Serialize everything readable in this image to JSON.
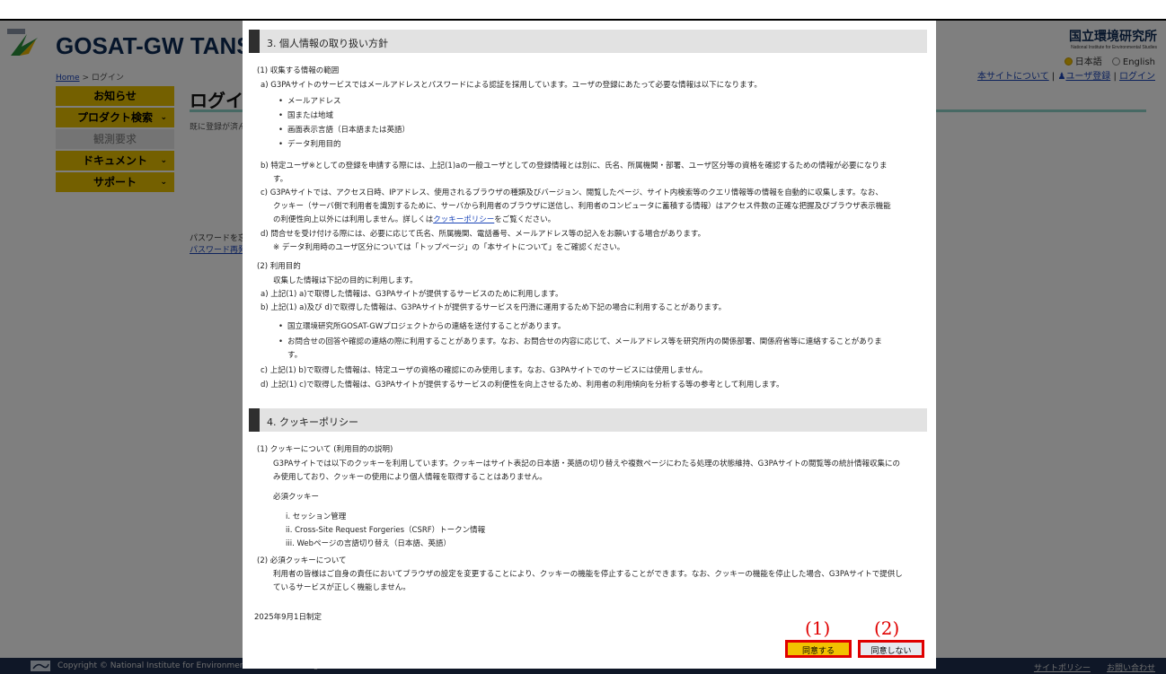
{
  "header": {
    "logo_small": "GOSAT-GW",
    "site_title": "GOSAT-GW TANSO",
    "nies_name_jp": "国立環境研究所",
    "nies_name_en": "National Institute for Environmental Studies",
    "lang_ja": "日本語",
    "lang_en": "English",
    "breadcrumb_home": "Home",
    "breadcrumb_sep": " > ",
    "breadcrumb_current": "ログイン",
    "link_about": "本サイトについて",
    "link_register": "ユーザ登録",
    "link_login": "ログイン"
  },
  "sidebar": {
    "items": [
      {
        "label": "お知らせ",
        "has_chevron": false
      },
      {
        "label": "プロダクト検索",
        "has_chevron": true
      },
      {
        "label": "観測要求",
        "has_chevron": false
      },
      {
        "label": "ドキュメント",
        "has_chevron": true
      },
      {
        "label": "サポート",
        "has_chevron": true
      }
    ]
  },
  "main": {
    "page_title": "ログイン",
    "login_note": "既に登録が済ん",
    "pw_text": "パスワードを忘",
    "pw_link": "パスワード再発"
  },
  "footer": {
    "copyright": "Copyright © National Institute for Environmental Studies. All Rights Reserved.",
    "link_policy": "サイトポリシー",
    "link_contact": "お問い合わせ"
  },
  "modal": {
    "sec3_title": "3. 個人情報の取り扱い方針",
    "s3_1": "(1) 収集する情報の範囲",
    "s3_1a": "a) G3PAサイトのサービスではメールアドレスとパスワードによる認証を採用しています。ユーザの登録にあたって必要な情報は以下になります。",
    "s3_1a_items": [
      "メールアドレス",
      "国または地域",
      "画面表示言語（日本語または英語）",
      "データ利用目的"
    ],
    "s3_1b_1": "b) 特定ユーザ※としての登録を申請する際には、上記(1)aの一般ユーザとしての登録情報とは別に、氏名、所属機関・部署、ユーザ区分等の資格を確認するための情報が必要になりま",
    "s3_1b_2": "す。",
    "s3_1c_1": "c) G3PAサイトでは、アクセス日時、IPアドレス、使用されるブラウザの種類及びバージョン、閲覧したページ、サイト内検索等のクエリ情報等の情報を自動的に収集します。なお、",
    "s3_1c_2": "クッキー（サーバ側で利用者を識別するために、サーバから利用者のブラウザに送信し、利用者のコンピュータに蓄積する情報）はアクセス件数の正確な把握及びブラウザ表示機能",
    "s3_1c_3a": "の利便性向上以外には利用しません。詳しくは",
    "s3_1c_3link": "クッキーポリシー",
    "s3_1c_3b": "をご覧ください。",
    "s3_1d": "d) 問合せを受け付ける際には、必要に応じて氏名、所属機関、電話番号、メールアドレス等の記入をお願いする場合があります。",
    "s3_1note": "※ データ利用時のユーザ区分については「トップページ」の「本サイトについて」をご確認ください。",
    "s3_2": "(2) 利用目的",
    "s3_2intro": "収集した情報は下記の目的に利用します。",
    "s3_2a": "a) 上記(1) a)で取得した情報は、G3PAサイトが提供するサービスのために利用します。",
    "s3_2b": "b) 上記(1) a)及び d)で取得した情報は、G3PAサイトが提供するサービスを円滑に運用するため下記の場合に利用することがあります。",
    "s3_2b_i1": "国立環境研究所GOSAT-GWプロジェクトからの連絡を送付することがあります。",
    "s3_2b_i2_1": "お問合せの回答や確認の連絡の際に利用することがあります。なお、お問合せの内容に応じて、メールアドレス等を研究所内の関係部署、関係府省等に連絡することがありま",
    "s3_2b_i2_2": "す。",
    "s3_2c": "c) 上記(1) b)で取得した情報は、特定ユーザの資格の確認にのみ使用します。なお、G3PAサイトでのサービスには使用しません。",
    "s3_2d": "d) 上記(1) c)で取得した情報は、G3PAサイトが提供するサービスの利便性を向上させるため、利用者の利用傾向を分析する等の参考として利用します。",
    "sec4_title": "4. クッキーポリシー",
    "s4_1": "(1) クッキーについて (利用目的の説明)",
    "s4_1p1": "G3PAサイトでは以下のクッキーを利用しています。クッキーはサイト表記の日本語・英語の切り替えや複数ページにわたる処理の状態維持、G3PAサイトの閲覧等の統計情報収集にの",
    "s4_1p2": "み使用しており、クッキーの使用により個人情報を取得することはありません。",
    "s4_req": "必須クッキー",
    "s4_i": "i. セッション管理",
    "s4_ii": "ii. Cross-Site Request Forgeries（CSRF）トークン情報",
    "s4_iii": "iii. Webページの言語切り替え（日本語、英語）",
    "s4_2": "(2) 必須クッキーについて",
    "s4_2p1": "利用者の皆様はご自身の責任においてブラウザの設定を変更することにより、クッキーの機能を停止することができます。なお、クッキーの機能を停止した場合、G3PAサイトで提供し",
    "s4_2p2": "ているサービスが正しく機能しません。",
    "enacted": "2025年9月1日制定",
    "agree_label": "同意する",
    "disagree_label": "同意しない",
    "annotation_1": "(1)",
    "annotation_2": "(2)"
  },
  "colors": {
    "nav_yellow": "#e8c000",
    "agree_yellow": "#f2c200",
    "annotation_red": "#e00000",
    "title_navy": "#0d2a55",
    "footer_navy": "#1f2f4f"
  }
}
